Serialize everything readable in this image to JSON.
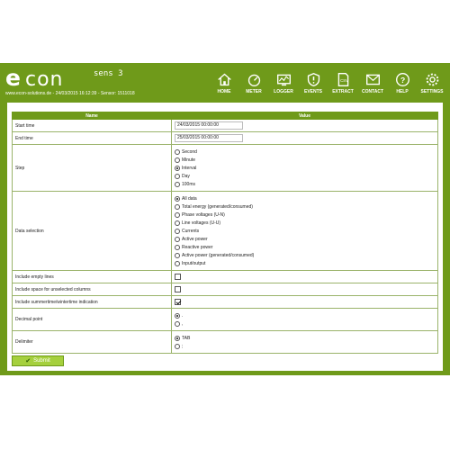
{
  "header": {
    "logo_e": "e",
    "logo_con": "con",
    "logo_product": "sens 3",
    "subline": "www.econ-solutions.de - 24/03/2015 16:12:39 - Sensor: 1511018",
    "brand_color": "#6f9a1a"
  },
  "nav": [
    {
      "label": "HOME",
      "icon": "home-icon"
    },
    {
      "label": "METER",
      "icon": "meter-icon"
    },
    {
      "label": "LOGGER",
      "icon": "logger-icon"
    },
    {
      "label": "EVENTS",
      "icon": "events-icon"
    },
    {
      "label": "EXTRACT",
      "icon": "extract-icon"
    },
    {
      "label": "CONTACT",
      "icon": "contact-icon"
    },
    {
      "label": "HELP",
      "icon": "help-icon"
    },
    {
      "label": "SETTINGS",
      "icon": "settings-icon"
    }
  ],
  "table": {
    "col_name": "Name",
    "col_value": "Value",
    "start_time": {
      "label": "Start time",
      "value": "24/03/2015 00:00:00"
    },
    "end_time": {
      "label": "End time",
      "value": "25/03/2015 00:00:00"
    },
    "step": {
      "label": "Step",
      "options": [
        "Second",
        "Minute",
        "Interval",
        "Day",
        "100ms"
      ],
      "selected": "Interval"
    },
    "data_selection": {
      "label": "Data selection",
      "options": [
        "All data",
        "Total energy (generated/consumed)",
        "Phase voltages (U-N)",
        "Line voltages (U-U)",
        "Currents",
        "Active power",
        "Reactive power",
        "Active power (generated/consumed)",
        "Input/output"
      ],
      "selected": "All data"
    },
    "empty_lines": {
      "label": "Include empty lines",
      "checked": false
    },
    "unselected_cols": {
      "label": "Include space for unselected columns",
      "checked": false
    },
    "dst": {
      "label": "Include summertime/wintertime indication",
      "checked": true
    },
    "decimal_point": {
      "label": "Decimal point",
      "options": [
        ".",
        ","
      ],
      "selected": "."
    },
    "delimiter": {
      "label": "Delimiter",
      "options": [
        "TAB",
        ";"
      ],
      "selected": "TAB"
    }
  },
  "submit_label": "Submit"
}
